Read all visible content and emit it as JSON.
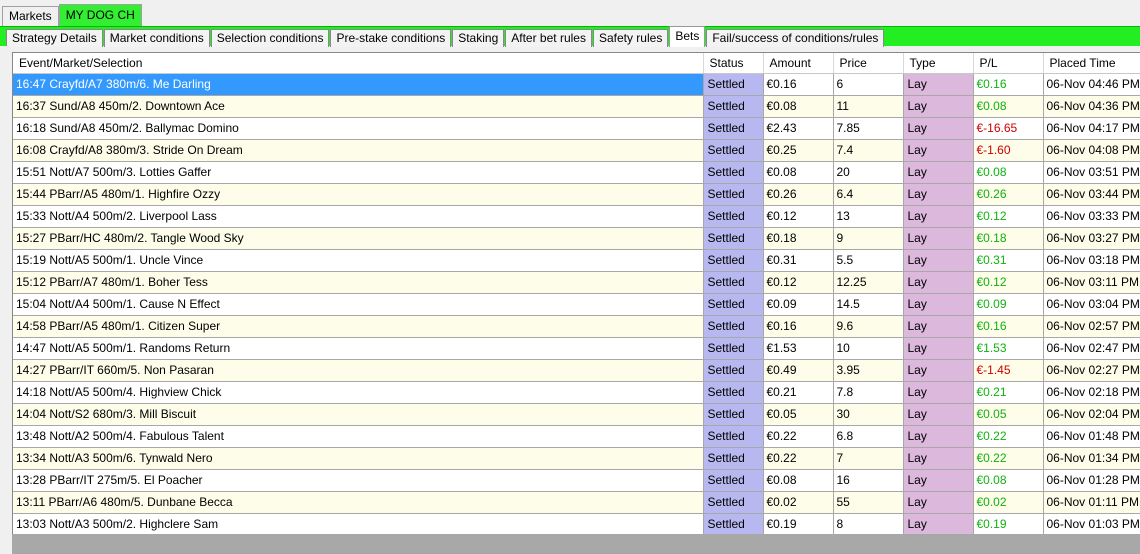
{
  "top_tabs": [
    {
      "label": "Markets",
      "active": false
    },
    {
      "label": "MY DOG CH",
      "active": true
    }
  ],
  "sub_tabs": [
    {
      "label": "Strategy Details",
      "active": false
    },
    {
      "label": "Market conditions",
      "active": false
    },
    {
      "label": "Selection conditions",
      "active": false
    },
    {
      "label": "Pre-stake conditions",
      "active": false
    },
    {
      "label": "Staking",
      "active": false
    },
    {
      "label": "After bet rules",
      "active": false
    },
    {
      "label": "Safety rules",
      "active": false
    },
    {
      "label": "Bets",
      "active": true
    },
    {
      "label": "Fail/success of conditions/rules",
      "active": false
    }
  ],
  "columns": [
    "Event/Market/Selection",
    "Status",
    "Amount",
    "Price",
    "Type",
    "P/L",
    "Placed Time"
  ],
  "colors": {
    "green_band": "#22ee22",
    "selected_row": "#3399ff",
    "status_cell": "#b8b8f0",
    "type_cell": "#dbb8dc",
    "pl_positive": "#10b010",
    "pl_negative": "#cc0000"
  },
  "bets": [
    {
      "selection": "16:47 Crayfd/A7 380m/6. Me Darling",
      "status": "Settled",
      "amount": "€0.16",
      "price": "6",
      "type": "Lay",
      "pl": "€0.16",
      "pl_sign": "pos",
      "time": "06-Nov 04:46 PM",
      "selected": true
    },
    {
      "selection": "16:37 Sund/A8 450m/2. Downtown Ace",
      "status": "Settled",
      "amount": "€0.08",
      "price": "11",
      "type": "Lay",
      "pl": "€0.08",
      "pl_sign": "pos",
      "time": "06-Nov 04:36 PM"
    },
    {
      "selection": "16:18 Sund/A8 450m/2. Ballymac Domino",
      "status": "Settled",
      "amount": "€2.43",
      "price": "7.85",
      "type": "Lay",
      "pl": "€-16.65",
      "pl_sign": "neg",
      "time": "06-Nov 04:17 PM"
    },
    {
      "selection": "16:08 Crayfd/A8 380m/3. Stride On Dream",
      "status": "Settled",
      "amount": "€0.25",
      "price": "7.4",
      "type": "Lay",
      "pl": "€-1.60",
      "pl_sign": "neg",
      "time": "06-Nov 04:08 PM"
    },
    {
      "selection": "15:51 Nott/A7 500m/3. Lotties Gaffer",
      "status": "Settled",
      "amount": "€0.08",
      "price": "20",
      "type": "Lay",
      "pl": "€0.08",
      "pl_sign": "pos",
      "time": "06-Nov 03:51 PM"
    },
    {
      "selection": "15:44 PBarr/A5 480m/1. Highfire Ozzy",
      "status": "Settled",
      "amount": "€0.26",
      "price": "6.4",
      "type": "Lay",
      "pl": "€0.26",
      "pl_sign": "pos",
      "time": "06-Nov 03:44 PM"
    },
    {
      "selection": "15:33 Nott/A4 500m/2. Liverpool Lass",
      "status": "Settled",
      "amount": "€0.12",
      "price": "13",
      "type": "Lay",
      "pl": "€0.12",
      "pl_sign": "pos",
      "time": "06-Nov 03:33 PM"
    },
    {
      "selection": "15:27 PBarr/HC 480m/2. Tangle Wood Sky",
      "status": "Settled",
      "amount": "€0.18",
      "price": "9",
      "type": "Lay",
      "pl": "€0.18",
      "pl_sign": "pos",
      "time": "06-Nov 03:27 PM"
    },
    {
      "selection": "15:19 Nott/A5 500m/1. Uncle Vince",
      "status": "Settled",
      "amount": "€0.31",
      "price": "5.5",
      "type": "Lay",
      "pl": "€0.31",
      "pl_sign": "pos",
      "time": "06-Nov 03:18 PM"
    },
    {
      "selection": "15:12 PBarr/A7 480m/1. Boher Tess",
      "status": "Settled",
      "amount": "€0.12",
      "price": "12.25",
      "type": "Lay",
      "pl": "€0.12",
      "pl_sign": "pos",
      "time": "06-Nov 03:11 PM"
    },
    {
      "selection": "15:04 Nott/A4 500m/1. Cause N Effect",
      "status": "Settled",
      "amount": "€0.09",
      "price": "14.5",
      "type": "Lay",
      "pl": "€0.09",
      "pl_sign": "pos",
      "time": "06-Nov 03:04 PM"
    },
    {
      "selection": "14:58 PBarr/A5 480m/1. Citizen Super",
      "status": "Settled",
      "amount": "€0.16",
      "price": "9.6",
      "type": "Lay",
      "pl": "€0.16",
      "pl_sign": "pos",
      "time": "06-Nov 02:57 PM"
    },
    {
      "selection": "14:47 Nott/A5 500m/1. Randoms Return",
      "status": "Settled",
      "amount": "€1.53",
      "price": "10",
      "type": "Lay",
      "pl": "€1.53",
      "pl_sign": "pos",
      "time": "06-Nov 02:47 PM"
    },
    {
      "selection": "14:27 PBarr/IT 660m/5. Non Pasaran",
      "status": "Settled",
      "amount": "€0.49",
      "price": "3.95",
      "type": "Lay",
      "pl": "€-1.45",
      "pl_sign": "neg",
      "time": "06-Nov 02:27 PM"
    },
    {
      "selection": "14:18 Nott/A5 500m/4. Highview Chick",
      "status": "Settled",
      "amount": "€0.21",
      "price": "7.8",
      "type": "Lay",
      "pl": "€0.21",
      "pl_sign": "pos",
      "time": "06-Nov 02:18 PM"
    },
    {
      "selection": "14:04 Nott/S2 680m/3. Mill Biscuit",
      "status": "Settled",
      "amount": "€0.05",
      "price": "30",
      "type": "Lay",
      "pl": "€0.05",
      "pl_sign": "pos",
      "time": "06-Nov 02:04 PM"
    },
    {
      "selection": "13:48 Nott/A2 500m/4. Fabulous Talent",
      "status": "Settled",
      "amount": "€0.22",
      "price": "6.8",
      "type": "Lay",
      "pl": "€0.22",
      "pl_sign": "pos",
      "time": "06-Nov 01:48 PM"
    },
    {
      "selection": "13:34 Nott/A3 500m/6. Tynwald Nero",
      "status": "Settled",
      "amount": "€0.22",
      "price": "7",
      "type": "Lay",
      "pl": "€0.22",
      "pl_sign": "pos",
      "time": "06-Nov 01:34 PM"
    },
    {
      "selection": "13:28 PBarr/IT 275m/5. El Poacher",
      "status": "Settled",
      "amount": "€0.08",
      "price": "16",
      "type": "Lay",
      "pl": "€0.08",
      "pl_sign": "pos",
      "time": "06-Nov 01:28 PM"
    },
    {
      "selection": "13:11 PBarr/A6 480m/5. Dunbane Becca",
      "status": "Settled",
      "amount": "€0.02",
      "price": "55",
      "type": "Lay",
      "pl": "€0.02",
      "pl_sign": "pos",
      "time": "06-Nov 01:11 PM"
    },
    {
      "selection": "13:03 Nott/A3 500m/2. Highclere Sam",
      "status": "Settled",
      "amount": "€0.19",
      "price": "8",
      "type": "Lay",
      "pl": "€0.19",
      "pl_sign": "pos",
      "time": "06-Nov 01:03 PM"
    }
  ]
}
